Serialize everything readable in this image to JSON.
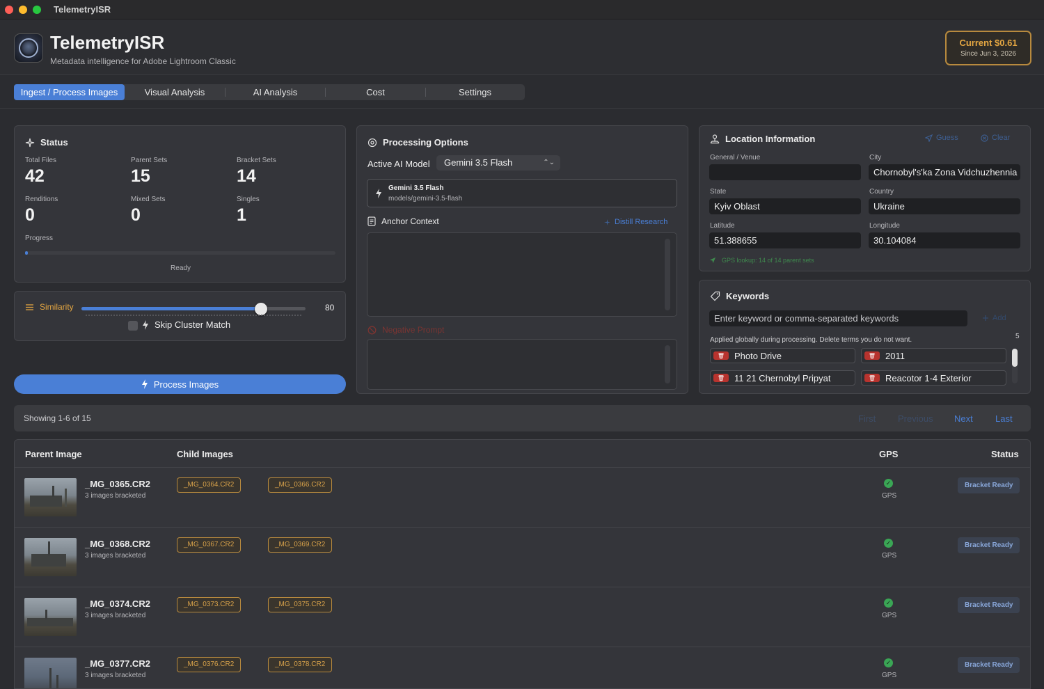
{
  "window": {
    "title": "TelemetryISR"
  },
  "header": {
    "app_name": "TelemetryISR",
    "subtitle": "Metadata intelligence for Adobe Lightroom Classic",
    "cost_label": "Current $0.61",
    "cost_since": "Since Jun 3, 2026"
  },
  "tabs": [
    {
      "label": "Ingest / Process Images",
      "active": true
    },
    {
      "label": "Visual Analysis"
    },
    {
      "label": "AI Analysis"
    },
    {
      "label": "Cost"
    },
    {
      "label": "Settings"
    }
  ],
  "status": {
    "title": "Status",
    "total_files_label": "Total Files",
    "total_files": "42",
    "parent_sets_label": "Parent Sets",
    "parent_sets": "15",
    "bracket_sets_label": "Bracket Sets",
    "bracket_sets": "14",
    "renditions_label": "Renditions",
    "renditions": "0",
    "mixed_sets_label": "Mixed Sets",
    "mixed_sets": "0",
    "singles_label": "Singles",
    "singles": "1",
    "progress_label": "Progress",
    "progress_fraction": 0.01,
    "state": "Ready"
  },
  "similarity": {
    "label": "Similarity",
    "value": "80",
    "min": 0,
    "max": 100,
    "skip_label": "Skip Cluster Match",
    "skip_checked": false
  },
  "process_button": {
    "label": "Process Images"
  },
  "processing": {
    "title": "Processing Options",
    "model_label": "Active AI Model",
    "model_selected": "Gemini 3.5 Flash",
    "model_name": "Gemini 3.5 Flash",
    "model_id": "models/gemini-3.5-flash",
    "anchor_label": "Anchor Context",
    "distill_label": "Distill Research",
    "negative_label": "Negative Prompt"
  },
  "location": {
    "title": "Location Information",
    "guess_label": "Guess",
    "clear_label": "Clear",
    "venue_label": "General / Venue",
    "venue": "",
    "city_label": "City",
    "city": "Chornobyl's'ka Zona Vidchuzhennia",
    "state_label": "State",
    "state": "Kyiv Oblast",
    "country_label": "Country",
    "country": "Ukraine",
    "lat_label": "Latitude",
    "lat": "51.388655",
    "lon_label": "Longitude",
    "lon": "30.104084",
    "gps_status": "GPS lookup: 14 of 14 parent sets"
  },
  "keywords": {
    "title": "Keywords",
    "input_placeholder": "Enter keyword or comma-separated keywords",
    "add_label": "Add",
    "hint": "Applied globally during processing. Delete terms you do not want.",
    "count": "5",
    "items": [
      "Photo Drive",
      "2011",
      "11 21 Chernobyl Pripyat",
      "Reacotor 1-4 Exterior"
    ]
  },
  "pagination": {
    "showing": "Showing 1-6 of 15",
    "first": "First",
    "previous": "Previous",
    "next": "Next",
    "last": "Last"
  },
  "table": {
    "headers": {
      "parent": "Parent Image",
      "children": "Child Images",
      "gps": "GPS",
      "status": "Status"
    },
    "rows": [
      {
        "name": "_MG_0365.CR2",
        "sub": "3 images bracketed",
        "children": [
          "_MG_0364.CR2",
          "_MG_0366.CR2"
        ],
        "gps": "GPS",
        "status": "Bracket Ready"
      },
      {
        "name": "_MG_0368.CR2",
        "sub": "3 images bracketed",
        "children": [
          "_MG_0367.CR2",
          "_MG_0369.CR2"
        ],
        "gps": "GPS",
        "status": "Bracket Ready"
      },
      {
        "name": "_MG_0374.CR2",
        "sub": "3 images bracketed",
        "children": [
          "_MG_0373.CR2",
          "_MG_0375.CR2"
        ],
        "gps": "GPS",
        "status": "Bracket Ready"
      },
      {
        "name": "_MG_0377.CR2",
        "sub": "3 images bracketed",
        "children": [
          "_MG_0376.CR2",
          "_MG_0378.CR2"
        ],
        "gps": "GPS",
        "status": "Bracket Ready"
      }
    ]
  },
  "colors": {
    "accent": "#4a7fd6",
    "cost": "#e5a742",
    "danger": "#b8332e",
    "ok": "#3aa655"
  },
  "icons": [
    "sparkle-icon",
    "gear-icon",
    "pin-icon",
    "tag-icon",
    "bolt-icon",
    "document-icon",
    "navigation-icon",
    "trash-icon",
    "check-icon",
    "sliders-icon",
    "forbidden-icon",
    "plus-icon",
    "clear-icon",
    "wand-icon"
  ]
}
